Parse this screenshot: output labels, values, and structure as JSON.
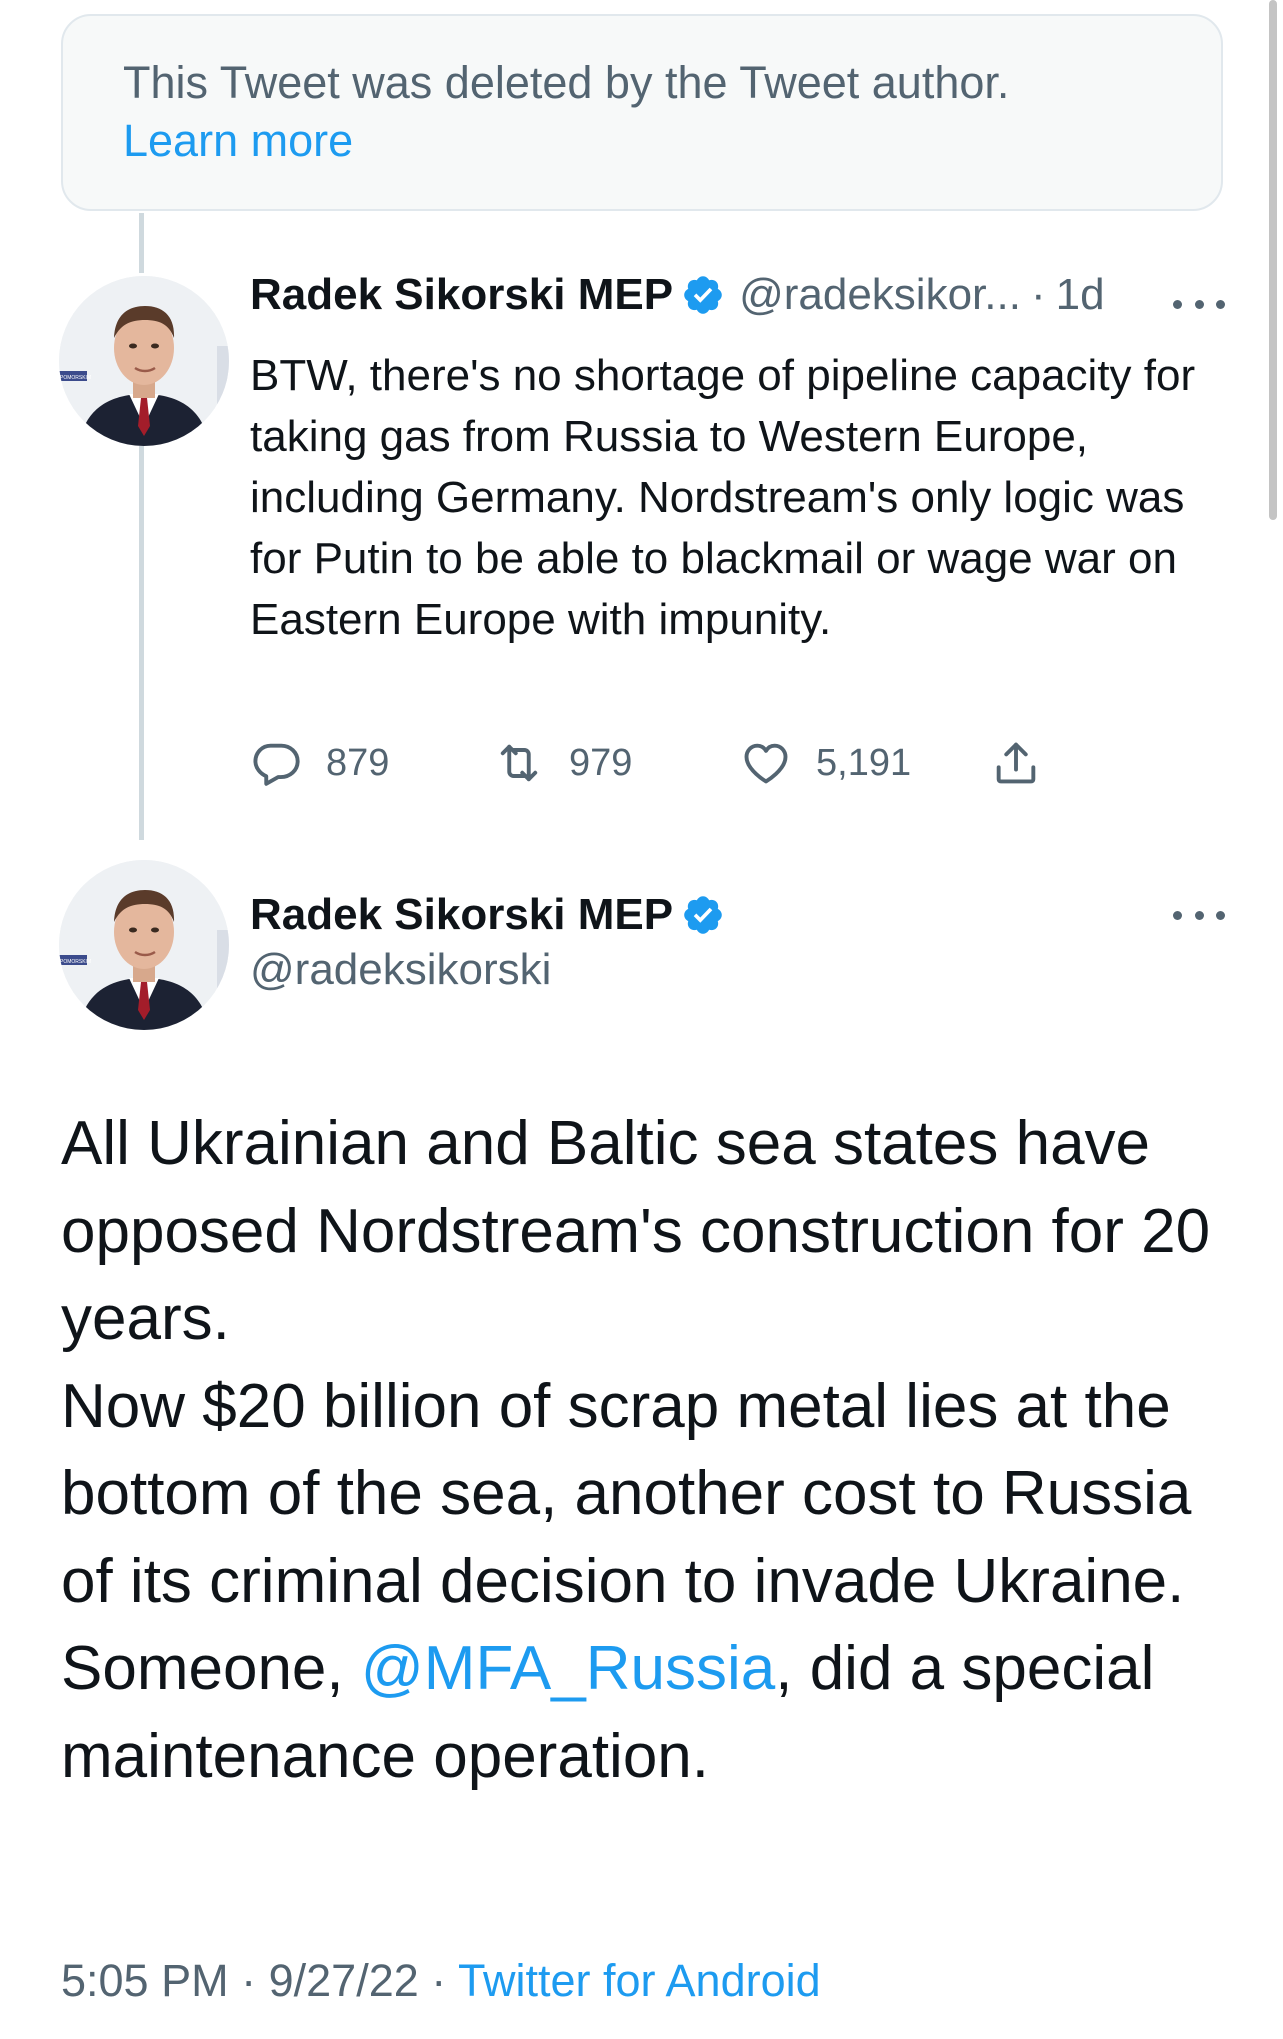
{
  "deleted_notice": {
    "text": "This Tweet was deleted by the Tweet author.",
    "link": "Learn more"
  },
  "reply_tweet": {
    "display_name": "Radek Sikorski MEP",
    "handle": "@radeksikor...",
    "separator": "·",
    "age": "1d",
    "text": "BTW, there's no shortage of pipeline capacity for taking gas from Russia to Western Europe, including Germany. Nordstream's only logic was for Putin to be able to blackmail or wage war on Eastern Europe with impunity.",
    "replies": "879",
    "retweets": "979",
    "likes": "5,191"
  },
  "main_tweet": {
    "display_name": "Radek Sikorski MEP",
    "handle": "@radeksikorski",
    "text_1": "All Ukrainian and Baltic sea states have opposed Nordstream's construction for 20 years.",
    "text_2": "Now $20 billion of scrap metal lies at the bottom of the sea, another cost to Russia of its criminal decision to invade Ukraine.",
    "text_3_before": "Someone, ",
    "mention": "@MFA_Russia",
    "text_3_after": ", did a special maintenance operation.",
    "time": "5:05 PM",
    "date": "9/27/22",
    "source": "Twitter for Android",
    "meta_separator": "·"
  },
  "avatar_badge_text": "POMORSKIM",
  "colors": {
    "accent": "#1d9bf0",
    "secondary_text": "#536471",
    "primary_text": "#0f1419",
    "thread_line": "#cfd9de"
  },
  "icons": [
    "verified-badge-icon",
    "more-icon",
    "reply-icon",
    "retweet-icon",
    "like-icon",
    "share-icon"
  ]
}
